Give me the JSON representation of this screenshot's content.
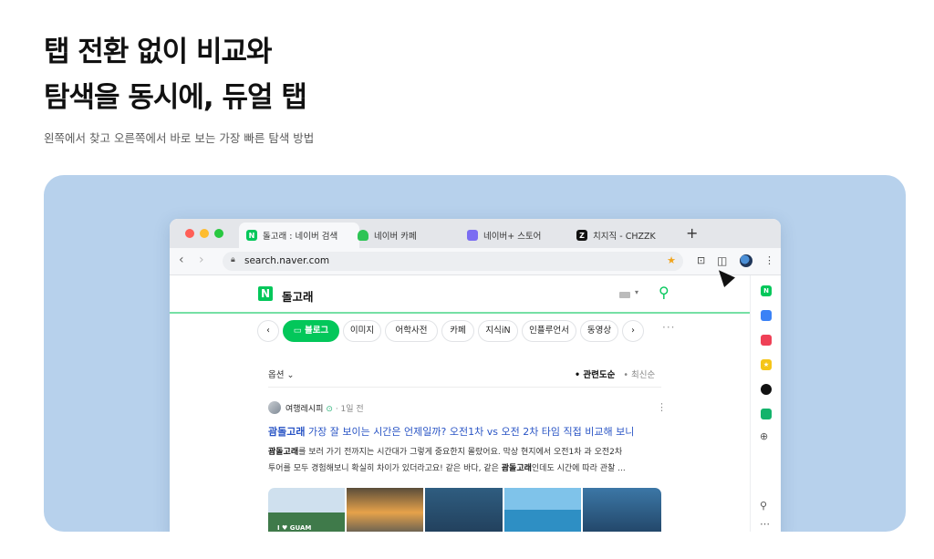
{
  "hero": {
    "title_line1": "탭 전환 없이 비교와",
    "title_line2": "탐색을 동시에, 듀얼 탭",
    "subtitle": "왼쪽에서 찾고 오른쪽에서 바로 보는 가장 빠른 탐색 방법"
  },
  "browser": {
    "tabs": [
      {
        "label": "돌고래 : 네이버 검색",
        "icon": "naver-icon",
        "active": true,
        "close": "✕"
      },
      {
        "label": "네이버 카페",
        "icon": "cafe-icon",
        "active": false
      },
      {
        "label": "네이버+ 스토어",
        "icon": "store-icon",
        "active": false
      },
      {
        "label": "치지직 - CHZZK",
        "icon": "chzzk-icon",
        "active": false
      }
    ],
    "new_tab": "+",
    "back": "‹",
    "forward": "›",
    "url": "search.naver.com",
    "toolbar_icons": [
      "capture-icon",
      "split-view-icon",
      "profile-avatar",
      "menu-icon"
    ],
    "colors": {
      "accent": "#03c75a",
      "background_stage": "#b7d1ec",
      "link": "#2a55c5"
    }
  },
  "page": {
    "logo": "N",
    "query": "돌고래",
    "chips": [
      "블로그",
      "이미지",
      "어학사전",
      "카페",
      "지식iN",
      "인플루언서",
      "동영상"
    ],
    "chip_prev": "‹",
    "chip_next": "›",
    "more": "···",
    "options_label": "옵션",
    "sort_active": "• 관련도순",
    "sort_inactive": "• 최신순",
    "post": {
      "author": "여행레시피",
      "time": "· 1일 전",
      "title_highlight": "괌돌고래",
      "title_rest": " 가장 잘 보이는 시간은 언제일까? 오전1차 vs 오전 2차 타임 직접 비교해 보니",
      "snippet_line1_bold": "괌돌고래",
      "snippet_line1": "를 보러 가기 전까지는 시간대가 그렇게 중요한지 몰랐어요. 막상 현지에서 오전1차 과 오전2차",
      "snippet_line2_a": "투어를 모두 경험해보니 확실히 차이가 있더라고요! 같은 바다, 같은 ",
      "snippet_line2_bold": "괌돌고래",
      "snippet_line2_b": "인데도 시간에 따라 관찰 ...",
      "thumb_caption": "I ♥ GUAM"
    }
  },
  "sidebar_icons": [
    "naver-icon",
    "calendar-icon",
    "pocket-icon",
    "bookmark-star-icon",
    "spotify-icon",
    "mail-icon",
    "add-icon",
    "pin-icon",
    "more-icon"
  ]
}
